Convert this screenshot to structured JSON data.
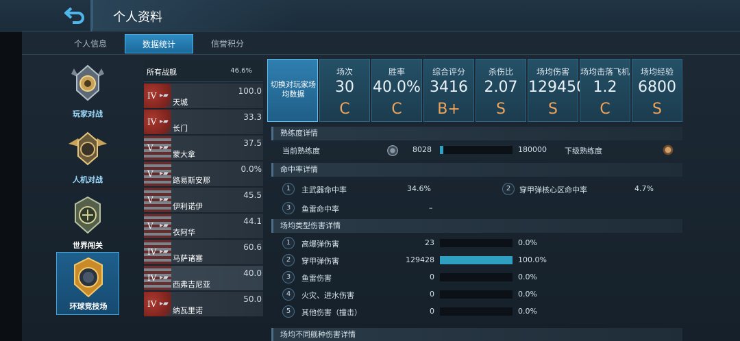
{
  "header": {
    "title": "个人资料",
    "back_icon": "back-arrow-icon",
    "accent": "#4fb6ec"
  },
  "tabs": [
    {
      "label": "个人信息",
      "active": false
    },
    {
      "label": "数据统计",
      "active": true
    },
    {
      "label": "信誉积分",
      "active": false
    }
  ],
  "modes": [
    {
      "label": "玩家对战",
      "active": false,
      "icon": "pvp-badge-icon"
    },
    {
      "label": "人机对战",
      "active": false,
      "icon": "pve-badge-icon"
    },
    {
      "label": "世界闯关",
      "active": false,
      "icon": "world-badge-icon"
    },
    {
      "label": "环球竞技场",
      "active": true,
      "icon": "arena-badge-icon"
    }
  ],
  "ships": {
    "all": {
      "name": "所有战舰",
      "pct": "46.6%"
    },
    "items": [
      {
        "tier": "IV",
        "name": "天城",
        "score": "100.0",
        "flag": "cn"
      },
      {
        "tier": "IV",
        "name": "长门",
        "score": "33.3",
        "flag": "cn"
      },
      {
        "tier": "V",
        "name": "蒙大拿",
        "score": "37.5",
        "flag": "us"
      },
      {
        "tier": "V",
        "name": "路易斯安那",
        "score": "0.0%",
        "flag": "us"
      },
      {
        "tier": "V",
        "name": "伊利诺伊",
        "score": "45.5",
        "flag": "us"
      },
      {
        "tier": "V",
        "name": "衣阿华",
        "score": "44.1",
        "flag": "us"
      },
      {
        "tier": "IV",
        "name": "马萨诸塞",
        "score": "60.6",
        "flag": "us"
      },
      {
        "tier": "IV",
        "name": "西弗吉尼亚",
        "score": "40.0",
        "flag": "us",
        "selected": true
      },
      {
        "tier": "IV",
        "name": "纳瓦里诺",
        "score": "50.0",
        "flag": "cn"
      }
    ]
  },
  "summary": {
    "switch_label": "切换对玩家场均数据",
    "cards": [
      {
        "label": "场次",
        "value": "30",
        "grade": "C"
      },
      {
        "label": "胜率",
        "value": "40.0%",
        "grade": "C"
      },
      {
        "label": "综合评分",
        "value": "3416",
        "grade": "B+"
      },
      {
        "label": "杀伤比",
        "value": "2.07",
        "grade": "S"
      },
      {
        "label": "场均伤害",
        "value": "129450",
        "grade": "S"
      },
      {
        "label": "场均击落飞机",
        "value": "1.2",
        "grade": "C"
      },
      {
        "label": "场均经验",
        "value": "6800",
        "grade": "S"
      }
    ],
    "grade_color": "#f0a45a"
  },
  "proficiency": {
    "title": "熟练度详情",
    "current_label": "当前熟练度",
    "current_value": "8028",
    "next_value": "180000",
    "next_label": "下级熟练度",
    "progress": 0.045
  },
  "hitrate": {
    "title": "命中率详情",
    "items": [
      {
        "num": "1",
        "label": "主武器命中率",
        "value": "34.6%"
      },
      {
        "num": "2",
        "label": "穿甲弹核心区命中率",
        "value": "4.7%"
      },
      {
        "num": "3",
        "label": "鱼雷命中率",
        "value": "–"
      }
    ]
  },
  "damage_types": {
    "title": "场均类型伤害详情",
    "items": [
      {
        "num": "1",
        "label": "高爆弹伤害",
        "value": "23",
        "pct": "0.0%",
        "fraction": 0.0
      },
      {
        "num": "2",
        "label": "穿甲弹伤害",
        "value": "129428",
        "pct": "100.0%",
        "fraction": 1.0
      },
      {
        "num": "3",
        "label": "鱼雷伤害",
        "value": "0",
        "pct": "0.0%",
        "fraction": 0.0
      },
      {
        "num": "4",
        "label": "火灾、进水伤害",
        "value": "0",
        "pct": "0.0%",
        "fraction": 0.0
      },
      {
        "num": "5",
        "label": "其他伤害（撞击）",
        "value": "0",
        "pct": "0.0%",
        "fraction": 0.0
      }
    ]
  },
  "ship_damage": {
    "title": "场均不同舰种伤害详情"
  }
}
